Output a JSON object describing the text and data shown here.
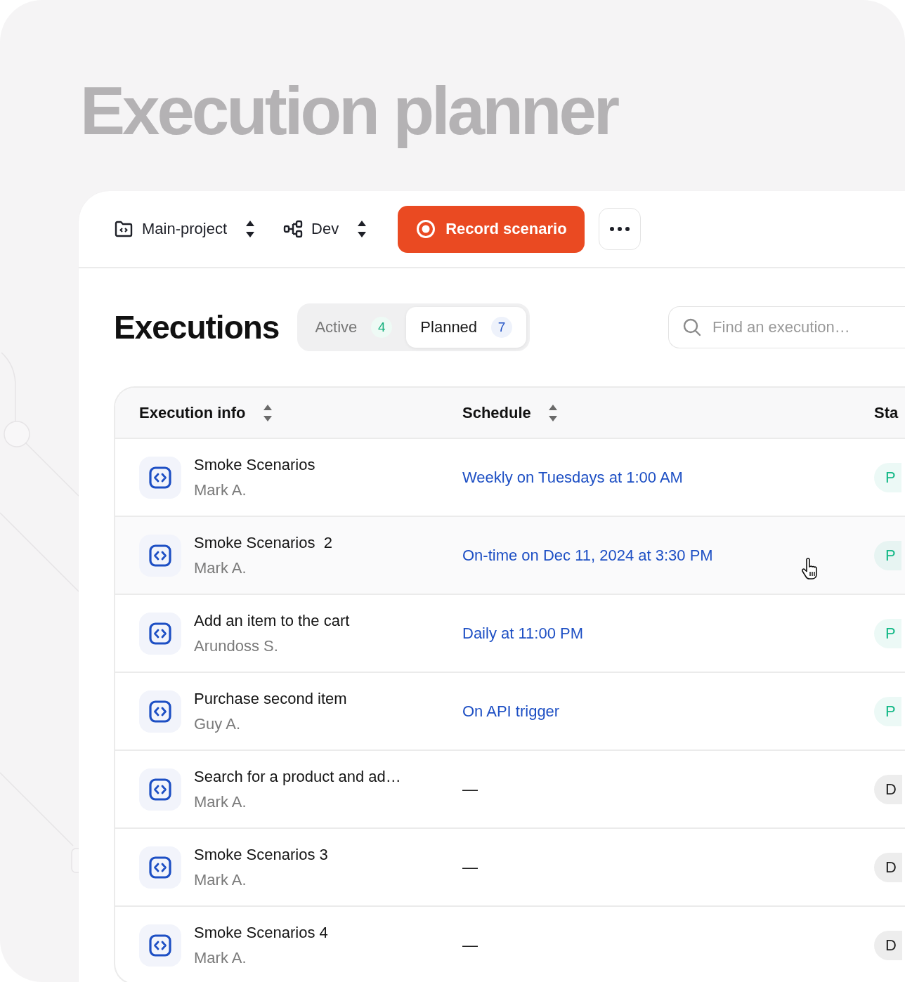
{
  "title": "Execution planner",
  "toolbar": {
    "project": "Main-project",
    "environment": "Dev",
    "record_button": "Record scenario"
  },
  "executions": {
    "heading": "Executions",
    "tabs": [
      {
        "label": "Active",
        "count": "4",
        "selected": false
      },
      {
        "label": "Planned",
        "count": "7",
        "selected": true
      }
    ],
    "search": {
      "placeholder": "Find an execution…"
    }
  },
  "table": {
    "columns": [
      {
        "label": "Execution info",
        "sortable": true
      },
      {
        "label": "Schedule",
        "sortable": true
      },
      {
        "label": "Sta",
        "sortable": false
      }
    ],
    "rows": [
      {
        "name": "Smoke Scenarios",
        "owner": "Mark A.",
        "schedule": {
          "text": "Weekly on Tuesdays at 1:00 AM",
          "kind": "link"
        },
        "status": {
          "text": "P",
          "color": "#12b886"
        },
        "hovered": false
      },
      {
        "name": "Smoke Scenarios  2",
        "owner": "Mark A.",
        "schedule": {
          "text": "On-time on Dec 11, 2024 at 3:30 PM",
          "kind": "link"
        },
        "status": {
          "text": "P",
          "color": "#12b886"
        },
        "hovered": true
      },
      {
        "name": "Add an item to the cart",
        "owner": "Arundoss S.",
        "schedule": {
          "text": "Daily at 11:00 PM",
          "kind": "link"
        },
        "status": {
          "text": "P",
          "color": "#12b886"
        },
        "hovered": false
      },
      {
        "name": "Purchase second item",
        "owner": "Guy A.",
        "schedule": {
          "text": "On API trigger",
          "kind": "link"
        },
        "status": {
          "text": "P",
          "color": "#12b886"
        },
        "hovered": false
      },
      {
        "name": "Search for a product and ad…",
        "owner": "Mark A.",
        "schedule": {
          "text": "—",
          "kind": "empty"
        },
        "status": {
          "text": "D",
          "color": "#1f1f1f"
        },
        "hovered": false
      },
      {
        "name": "Smoke Scenarios 3",
        "owner": "Mark A.",
        "schedule": {
          "text": "—",
          "kind": "empty"
        },
        "status": {
          "text": "D",
          "color": "#1f1f1f"
        },
        "hovered": false
      },
      {
        "name": "Smoke Scenarios 4",
        "owner": "Mark A.",
        "schedule": {
          "text": "—",
          "kind": "empty"
        },
        "status": {
          "text": "D",
          "color": "#1f1f1f"
        },
        "hovered": false
      }
    ]
  }
}
